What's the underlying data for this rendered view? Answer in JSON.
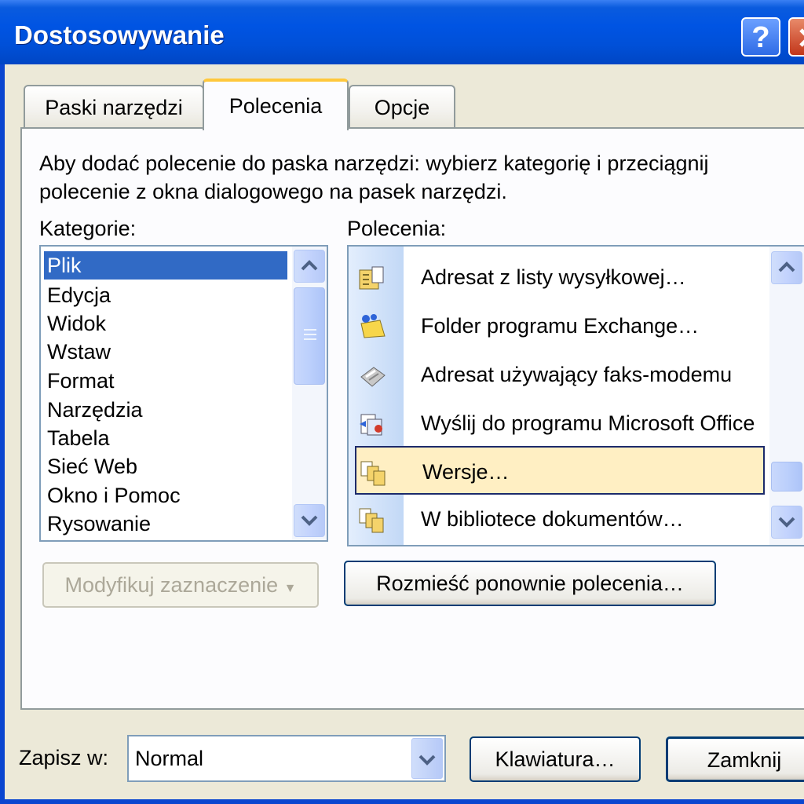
{
  "window": {
    "title": "Dostosowywanie",
    "help_label": "?"
  },
  "tabs": [
    {
      "label": "Paski narzędzi"
    },
    {
      "label": "Polecenia"
    },
    {
      "label": "Opcje"
    }
  ],
  "main": {
    "description": "Aby dodać polecenie do paska narzędzi: wybierz kategorię i przeciągnij polecenie z okna dialogowego na pasek narzędzi.",
    "categories_label": "Kategorie:",
    "commands_label": "Polecenia:",
    "categories": [
      "Plik",
      "Edycja",
      "Widok",
      "Wstaw",
      "Format",
      "Narzędzia",
      "Tabela",
      "Sieć Web",
      "Okno i Pomoc",
      "Rysowanie"
    ],
    "selected_category": "Plik",
    "commands": [
      {
        "label": "Adresat z listy wysyłkowej…",
        "icon": "address-list-icon"
      },
      {
        "label": "Folder programu Exchange…",
        "icon": "exchange-folder-icon"
      },
      {
        "label": "Adresat używający faks-modemu",
        "icon": "fax-icon"
      },
      {
        "label": "Wyślij do programu Microsoft Office",
        "icon": "send-to-office-icon"
      },
      {
        "label": "Wersje…",
        "icon": "versions-icon"
      },
      {
        "label": "W bibliotece dokumentów…",
        "icon": "document-library-icon"
      }
    ],
    "highlighted_command": "Wersje…",
    "modify_selection_label": "Modyfikuj zaznaczenie",
    "rearrange_label": "Rozmieść ponownie polecenia…"
  },
  "footer": {
    "save_in_label": "Zapisz w:",
    "save_in_value": "Normal",
    "keyboard_label": "Klawiatura…",
    "close_label": "Zamknij"
  }
}
